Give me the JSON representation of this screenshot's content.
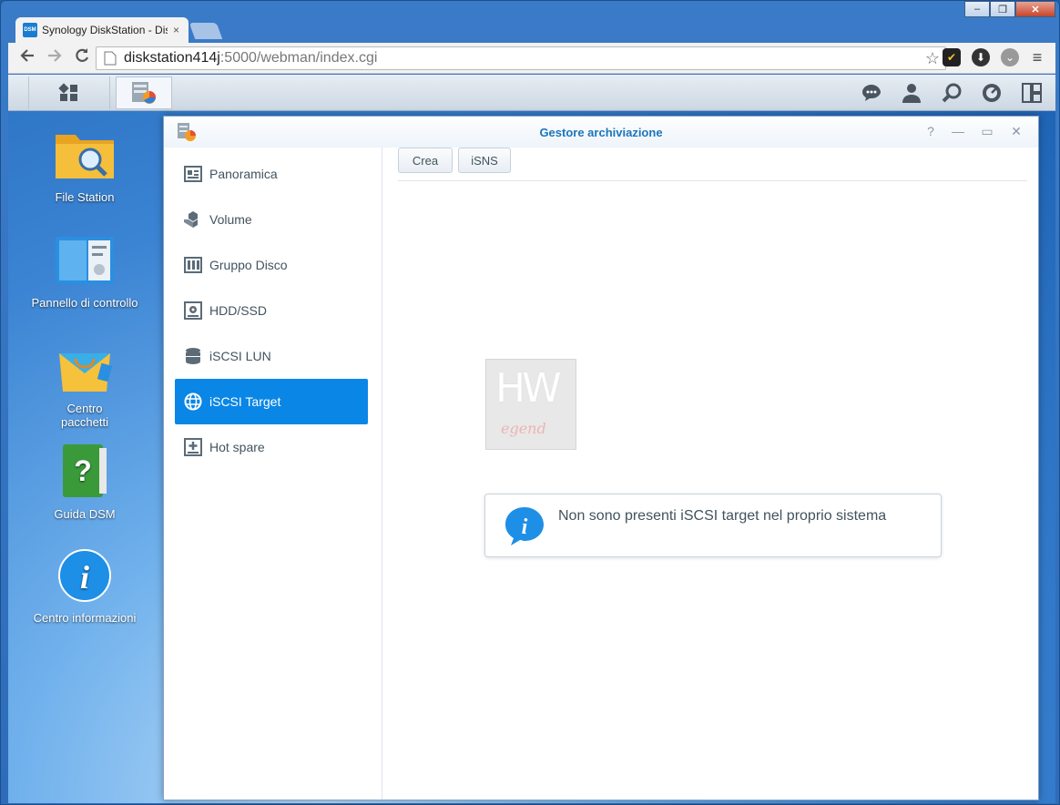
{
  "browser": {
    "tab_title": "Synology DiskStation - Dis",
    "tab_favicon": "DSM",
    "tab_close": "×",
    "url_host": "diskstation414j",
    "url_path": ":5000/webman/index.cgi",
    "window_min": "–",
    "window_max": "❐",
    "window_close": "✕"
  },
  "desktop": {
    "icons": [
      {
        "label": "File Station"
      },
      {
        "label": "Pannello di controllo"
      },
      {
        "label": "Centro pacchetti"
      },
      {
        "label": "Guida DSM"
      },
      {
        "label": "Centro informazioni"
      }
    ]
  },
  "window": {
    "title": "Gestore archiviazione",
    "help": "?",
    "minimize": "—",
    "maximize": "▭",
    "close": "✕"
  },
  "sidebar": {
    "items": [
      {
        "label": "Panoramica",
        "icon": "overview-icon"
      },
      {
        "label": "Volume",
        "icon": "volume-icon"
      },
      {
        "label": "Gruppo Disco",
        "icon": "disk-group-icon"
      },
      {
        "label": "HDD/SSD",
        "icon": "hdd-icon"
      },
      {
        "label": "iSCSI LUN",
        "icon": "iscsi-lun-icon"
      },
      {
        "label": "iSCSI Target",
        "icon": "globe-icon",
        "active": true
      },
      {
        "label": "Hot spare",
        "icon": "hot-spare-icon"
      }
    ]
  },
  "toolbar": {
    "create_label": "Crea",
    "isns_label": "iSNS"
  },
  "watermark": {
    "top": "HW",
    "bottom": "egend"
  },
  "empty_state": {
    "message": "Non sono presenti iSCSI target nel proprio sistema"
  },
  "colors": {
    "accent": "#0a86e6",
    "title": "#1c75bc"
  }
}
